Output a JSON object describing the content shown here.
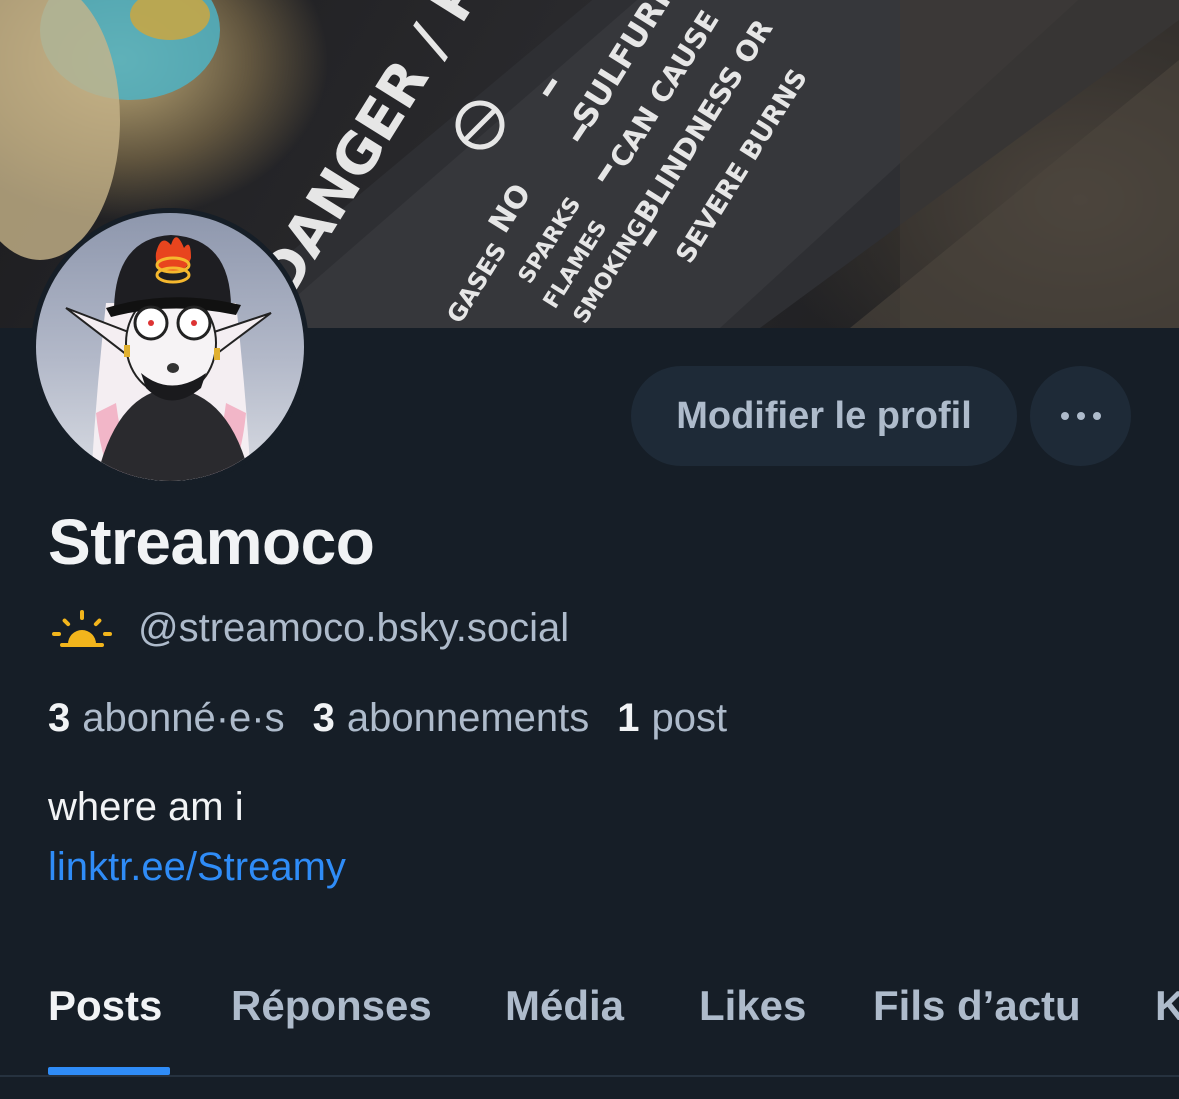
{
  "profile": {
    "display_name": "Streamoco",
    "handle": "@streamoco.bsky.social",
    "status_icon": "sunrise-icon",
    "bio": "where am i",
    "link": "linktr.ee/Streamy"
  },
  "actions": {
    "edit_label": "Modifier le profil",
    "more_icon": "ellipsis-icon"
  },
  "stats": {
    "followers_count": "3",
    "followers_label": "abonné·e·s",
    "following_count": "3",
    "following_label": "abonnements",
    "posts_count": "1",
    "posts_label": "post"
  },
  "banner": {
    "text_1": "DANGER / POI",
    "text_2": "NO",
    "text_3": "SULFURIC",
    "text_4": "CAN CAUSE",
    "text_5": "BLINDNESS OR",
    "text_6": "SEVERE BURNS",
    "text_7": "SPARKS",
    "text_8": "FLAMES",
    "text_9": "SMOKING",
    "text_10": "GASES"
  },
  "tabs": [
    {
      "label": "Posts"
    },
    {
      "label": "Réponses"
    },
    {
      "label": "Média"
    },
    {
      "label": "Likes"
    },
    {
      "label": "Fils d’actu"
    },
    {
      "label": "K"
    }
  ],
  "colors": {
    "background": "#161e27",
    "accent": "#2f8cf7",
    "secondary_text": "#aebbcb",
    "button_bg": "#1e2a37"
  }
}
